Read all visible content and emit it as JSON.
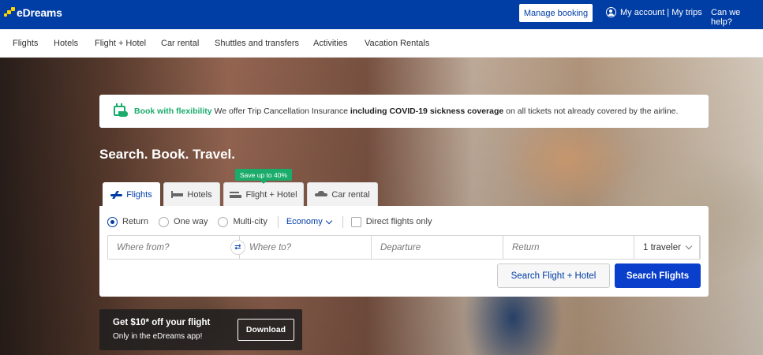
{
  "header": {
    "logo_text": "eDreams",
    "manage_booking": "Manage booking",
    "account": "My account | My trips",
    "help": "Can we help?"
  },
  "nav": {
    "items": [
      "Flights",
      "Hotels",
      "Flight + Hotel",
      "Car rental",
      "Shuttles and transfers",
      "Activities",
      "Vacation Rentals"
    ]
  },
  "banner": {
    "green": "Book with flexibility",
    "text1": " We offer Trip Cancellation Insurance ",
    "bold": "including COVID-19 sickness coverage",
    "text2": " on all tickets not already covered by the airline."
  },
  "headline": "Search. Book. Travel.",
  "tabs": {
    "save_badge": "Save up to 40%",
    "items": [
      "Flights",
      "Hotels",
      "Flight + Hotel",
      "Car rental"
    ]
  },
  "search": {
    "trip_types": [
      "Return",
      "One way",
      "Multi-city"
    ],
    "cabin": "Economy",
    "direct": "Direct flights only",
    "from_placeholder": "Where from?",
    "to_placeholder": "Where to?",
    "departure_placeholder": "Departure",
    "return_placeholder": "Return",
    "travelers": "1 traveler",
    "btn_hotel": "Search Flight + Hotel",
    "btn_flights": "Search Flights"
  },
  "app": {
    "title": "Get $10* off your flight",
    "subtitle": "Only in the eDreams app!",
    "download": "Download"
  },
  "colors": {
    "brand": "#003da5",
    "green": "#1aac6b",
    "search_button": "#0a3fcc"
  }
}
